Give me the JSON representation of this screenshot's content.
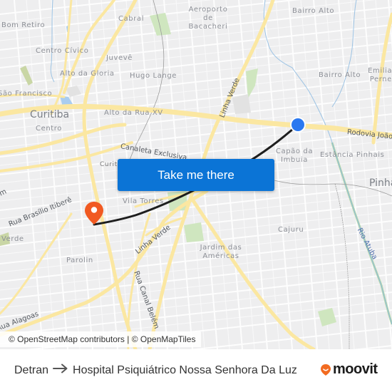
{
  "map": {
    "attribution": "© OpenStreetMap contributors | © OpenMapTiles",
    "places": [
      {
        "id": "bairro-alto-n",
        "label": "Bairro Alto"
      },
      {
        "id": "aeroporto",
        "label": "Aeroporto de Bacacheri"
      },
      {
        "id": "cabral",
        "label": "Cabral"
      },
      {
        "id": "bom-retiro",
        "label": "Bom Retiro"
      },
      {
        "id": "centro-civico",
        "label": "Centro Cívico"
      },
      {
        "id": "juveve",
        "label": "Juvevê"
      },
      {
        "id": "alto-da-gloria",
        "label": "Alto da Gloria"
      },
      {
        "id": "hugo-lange",
        "label": "Hugo Lange"
      },
      {
        "id": "sao-francisco",
        "label": "São Francisco"
      },
      {
        "id": "curitiba",
        "label": "Curitiba"
      },
      {
        "id": "centro",
        "label": "Centro"
      },
      {
        "id": "alto-da-rua-xv",
        "label": "Alto da Rua XV"
      },
      {
        "id": "bairro-alto-s",
        "label": "Bairro Alto"
      },
      {
        "id": "emiliano-perneta",
        "label": "Emiliano Perneta"
      },
      {
        "id": "capao-da-imbuia",
        "label": "Capão da Imbuia"
      },
      {
        "id": "estancia-pinhais",
        "label": "Estância Pinhais"
      },
      {
        "id": "pinhais",
        "label": "Pinhais"
      },
      {
        "id": "curitiba-small",
        "label": "Curitib"
      },
      {
        "id": "vila-torres",
        "label": "Vila Torres"
      },
      {
        "id": "verde-w",
        "label": "Verde"
      },
      {
        "id": "parolin",
        "label": "Parolin"
      },
      {
        "id": "cajuru",
        "label": "Cajuru"
      },
      {
        "id": "jardim-das-americas",
        "label": "Jardim das Américas"
      }
    ],
    "roads": [
      {
        "id": "linha-verde-n",
        "label": "Linha Verde"
      },
      {
        "id": "rodovia-joao",
        "label": "Rodovia João"
      },
      {
        "id": "canaleta",
        "label": "Canaleta Exclusiva"
      },
      {
        "id": "rua-brasilio",
        "label": "Rua Brasílio Itiberê"
      },
      {
        "id": "linha-verde-s",
        "label": "Linha Verde"
      },
      {
        "id": "rua-canal-belem",
        "label": "Rua Canal Belém"
      },
      {
        "id": "rua-alagoas",
        "label": "Rua Alagoas"
      },
      {
        "id": "m-edge",
        "label": "m"
      }
    ],
    "rivers": [
      {
        "id": "rio-atuba",
        "label": "Rio Atuba"
      }
    ],
    "origin_marker": {
      "name": "Detran",
      "color": "#2a78f0"
    },
    "destination_marker": {
      "name": "Hospital Psiquiátrico Nossa Senhora Da Luz",
      "color": "#f15a22"
    },
    "route_color": "#1e1e1e",
    "road_color": "#fbe7a1",
    "park_color": "#cfe6bf"
  },
  "cta": {
    "label": "Take me there",
    "color": "#0b74d6"
  },
  "footer": {
    "origin": "Detran",
    "destination": "Hospital Psiquiátrico Nossa Senhora Da Luz",
    "brand": "moovit",
    "brand_color": "#f26b21"
  }
}
